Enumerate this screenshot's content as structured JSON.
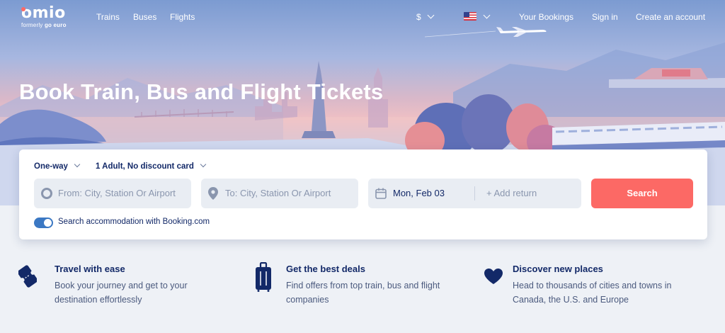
{
  "brand": {
    "name": "omio",
    "tagline_prefix": "formerly",
    "tagline_brand": "go euro"
  },
  "nav": {
    "links": [
      "Trains",
      "Buses",
      "Flights"
    ],
    "currency": "$",
    "right_links": [
      "Your Bookings",
      "Sign in",
      "Create an account"
    ]
  },
  "hero": {
    "title": "Book Train, Bus and Flight Tickets"
  },
  "search": {
    "trip_type": "One-way",
    "passengers": "1 Adult, No discount card",
    "from_placeholder": "From: City, Station Or Airport",
    "to_placeholder": "To: City, Station Or Airport",
    "depart_date": "Mon, Feb 03",
    "return_label": "+ Add return",
    "button_label": "Search",
    "accommodation_label": "Search accommodation with Booking.com",
    "accommodation_enabled": true
  },
  "features": [
    {
      "title": "Travel with ease",
      "desc_line1": "Book your journey and get to your",
      "desc_line2": "destination effortlessly",
      "icon": "ticket-icon"
    },
    {
      "title": "Get the best deals",
      "desc_line1": "Find offers from top train, bus and flight",
      "desc_line2": "companies",
      "icon": "suitcase-icon"
    },
    {
      "title": "Discover new places",
      "desc_line1": "Head to thousands of cities and towns in",
      "desc_line2": "Canada, the U.S. and Europe",
      "icon": "heart-icon"
    }
  ],
  "colors": {
    "accent": "#fc6965",
    "navy": "#132968",
    "toggle": "#3b78c3"
  }
}
